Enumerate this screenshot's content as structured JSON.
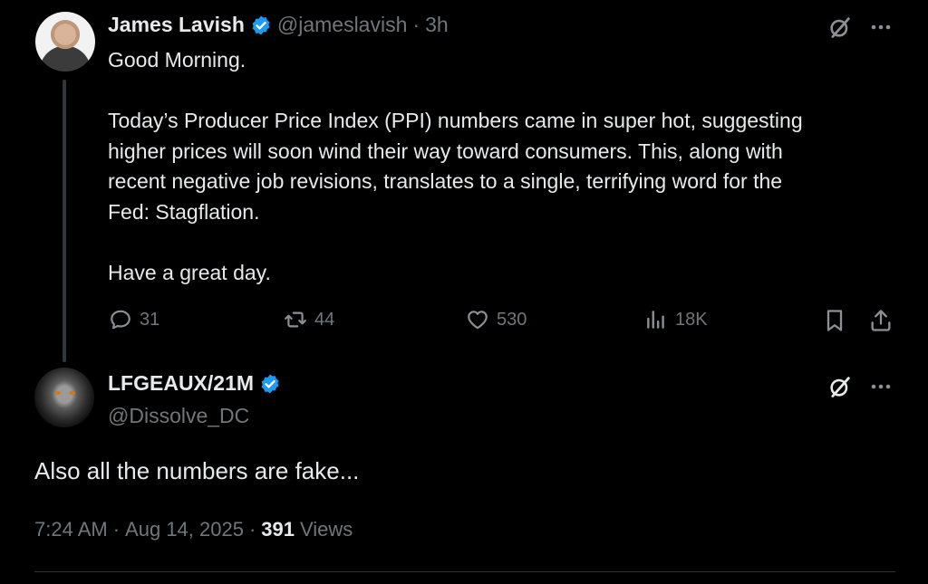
{
  "tweet": {
    "author_name": "James Lavish",
    "author_handle": "@jameslavish",
    "separator": "·",
    "time_ago": "3h",
    "lines": [
      "Good Morning.",
      "Today’s Producer Price Index (PPI) numbers came in super hot, suggesting",
      "higher prices will soon wind their way toward consumers. This, along with",
      "recent negative job revisions, translates to a single, terrifying word for the",
      "Fed: Stagflation.",
      "Have a great day."
    ],
    "actions": {
      "replies": "31",
      "reposts": "44",
      "likes": "530",
      "views": "18K"
    }
  },
  "reply": {
    "author_name": "LFGEAUX/21M",
    "author_handle": "@Dissolve_DC",
    "text": "Also all the numbers are fake...",
    "time": "7:24 AM",
    "date": "Aug 14, 2025",
    "sep1": "·",
    "sep2": "·",
    "views_count": "391",
    "views_label": "Views"
  },
  "colors": {
    "background": "#000000",
    "text": "#e7e9ea",
    "muted": "#71767b",
    "verified": "#1d9bf0",
    "divider": "#2f3336"
  },
  "icons": [
    "grok-icon",
    "more-icon",
    "reply-icon",
    "repost-icon",
    "like-icon",
    "views-icon",
    "bookmark-icon",
    "share-icon",
    "verified-badge-icon"
  ]
}
